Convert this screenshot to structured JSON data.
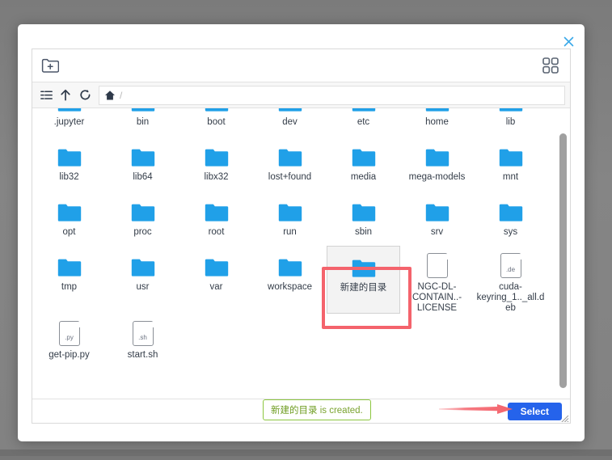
{
  "window": {
    "close_label": "✕"
  },
  "action_bar": {
    "new_folder_icon": "folder-plus-icon",
    "view_toggle_icon": "grid-view-icon"
  },
  "nav_bar": {
    "list_icon": "list-view-icon",
    "up_icon": "arrow-up-icon",
    "refresh_icon": "refresh-icon",
    "home_icon": "home-icon",
    "path_value": "/",
    "path_placeholder": "/"
  },
  "file_rows": [
    [
      {
        "name": ".jupyter",
        "type": "folder"
      },
      {
        "name": "bin",
        "type": "folder"
      },
      {
        "name": "boot",
        "type": "folder"
      },
      {
        "name": "dev",
        "type": "folder"
      },
      {
        "name": "etc",
        "type": "folder"
      },
      {
        "name": "home",
        "type": "folder"
      },
      {
        "name": "lib",
        "type": "folder"
      }
    ],
    [
      {
        "name": "lib32",
        "type": "folder"
      },
      {
        "name": "lib64",
        "type": "folder"
      },
      {
        "name": "libx32",
        "type": "folder"
      },
      {
        "name": "lost+found",
        "type": "folder"
      },
      {
        "name": "media",
        "type": "folder"
      },
      {
        "name": "mega-models",
        "type": "folder"
      },
      {
        "name": "mnt",
        "type": "folder"
      }
    ],
    [
      {
        "name": "opt",
        "type": "folder"
      },
      {
        "name": "proc",
        "type": "folder"
      },
      {
        "name": "root",
        "type": "folder"
      },
      {
        "name": "run",
        "type": "folder"
      },
      {
        "name": "sbin",
        "type": "folder"
      },
      {
        "name": "srv",
        "type": "folder"
      },
      {
        "name": "sys",
        "type": "folder"
      }
    ],
    [
      {
        "name": "tmp",
        "type": "folder"
      },
      {
        "name": "usr",
        "type": "folder"
      },
      {
        "name": "var",
        "type": "folder"
      },
      {
        "name": "workspace",
        "type": "folder"
      },
      {
        "name": "新建的目录",
        "type": "folder",
        "selected": true
      },
      {
        "name": "NGC-DL-CONTAIN..-LICENSE",
        "type": "file",
        "ext": ""
      },
      {
        "name": "cuda-keyring_1.._all.deb",
        "type": "file",
        "ext": ".de"
      }
    ],
    [
      {
        "name": "get-pip.py",
        "type": "file",
        "ext": ".py"
      },
      {
        "name": "start.sh",
        "type": "file",
        "ext": ".sh"
      }
    ]
  ],
  "toast": {
    "subject": "新建的目录",
    "message": " is created."
  },
  "footer": {
    "select_label": "Select"
  },
  "colors": {
    "folder_blue": "#20a0e8",
    "accent_button": "#2563eb",
    "annotation_red": "#f4636c",
    "toast_green": "#8cc63f",
    "close_blue": "#3aa9e8"
  }
}
